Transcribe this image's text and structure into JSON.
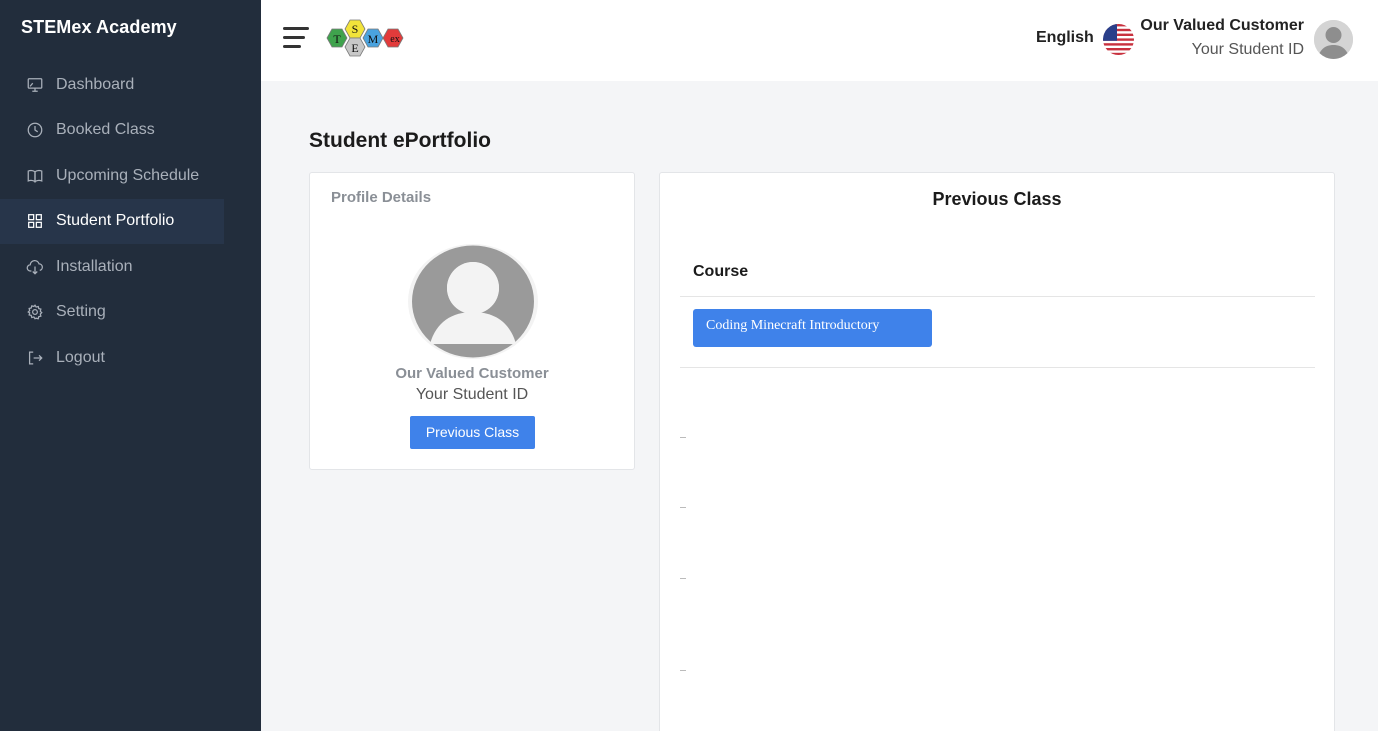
{
  "sidebar": {
    "brand": "STEMex Academy",
    "items": [
      {
        "label": "Dashboard",
        "icon": "monitor-icon",
        "active": false
      },
      {
        "label": "Booked Class",
        "icon": "clock-icon",
        "active": false
      },
      {
        "label": "Upcoming Schedule",
        "icon": "book-icon",
        "active": false
      },
      {
        "label": "Student Portfolio",
        "icon": "grid-icon",
        "active": true
      },
      {
        "label": "Installation",
        "icon": "cloud-download-icon",
        "active": false
      },
      {
        "label": "Setting",
        "icon": "gear-icon",
        "active": false
      },
      {
        "label": "Logout",
        "icon": "logout-icon",
        "active": false
      }
    ]
  },
  "header": {
    "language": "English",
    "user_name": "Our Valued Customer",
    "user_id": "Your Student ID",
    "logo_letters": [
      "T",
      "S",
      "E",
      "M",
      "ex"
    ]
  },
  "main": {
    "page_title": "Student ePortfolio",
    "profile": {
      "title": "Profile Details",
      "name": "Our Valued Customer",
      "student_id": "Your Student ID",
      "button_label": "Previous Class"
    },
    "previous_class": {
      "title": "Previous Class",
      "column_header": "Course",
      "courses": [
        "Coding Minecraft Introductory"
      ]
    }
  },
  "colors": {
    "sidebar_bg": "#222d3c",
    "accent": "#3f82ea",
    "page_bg": "#f4f5f7"
  }
}
